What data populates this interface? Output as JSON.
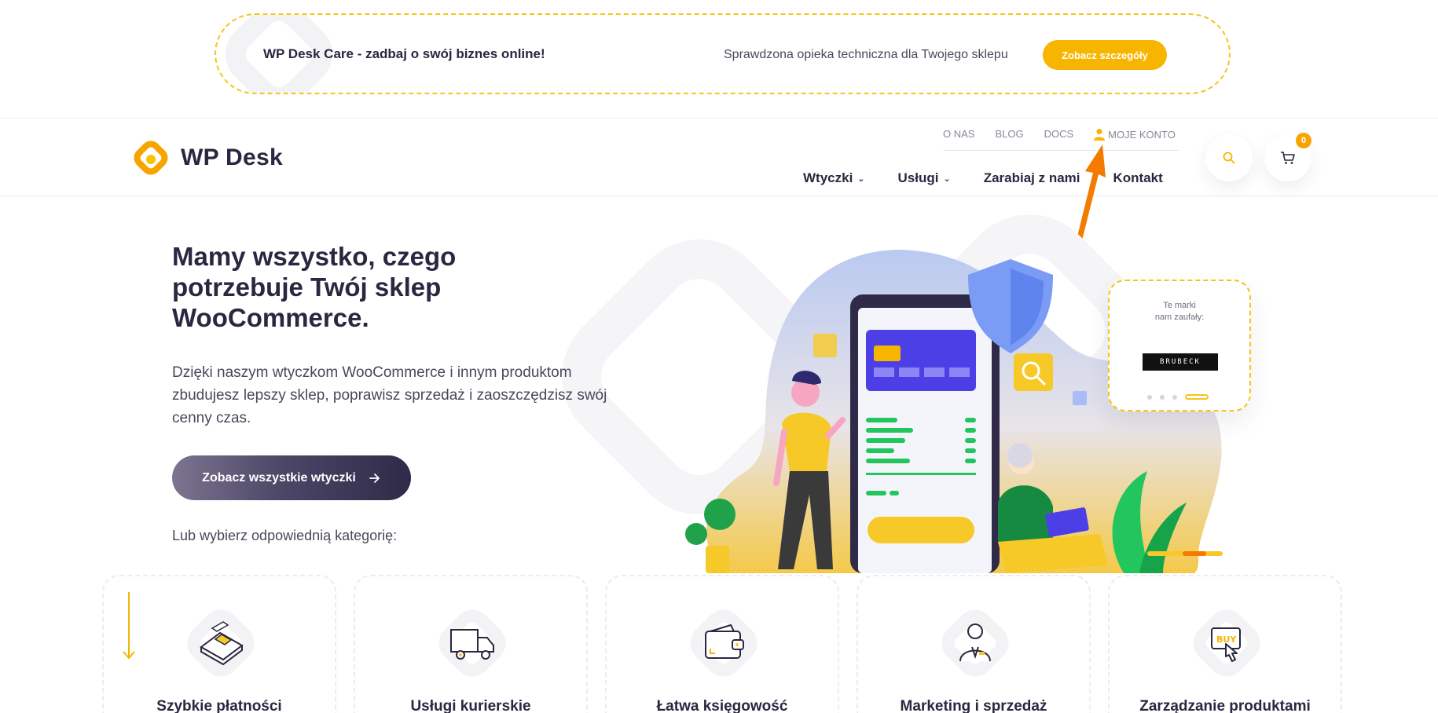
{
  "promo": {
    "title": "WP Desk Care - zadbaj o swój biznes online!",
    "subtitle": "Sprawdzona opieka techniczna dla Twojego sklepu",
    "button": "Zobacz szczegóły"
  },
  "header": {
    "logo_text": "WP Desk",
    "top_nav": [
      "O NAS",
      "BLOG",
      "DOCS"
    ],
    "account_label": "MOJE KONTO",
    "main_nav": [
      {
        "label": "Wtyczki",
        "has_dropdown": true
      },
      {
        "label": "Usługi",
        "has_dropdown": true
      },
      {
        "label": "Zarabiaj z nami",
        "has_dropdown": false
      },
      {
        "label": "Kontakt",
        "has_dropdown": false
      }
    ],
    "cart_count": "0"
  },
  "hero": {
    "title": "Mamy wszystko, czego potrzebuje Twój sklep WooCommerce.",
    "description": "Dzięki naszym wtyczkom WooCommerce i innym produktom zbudujesz lepszy sklep, poprawisz sprzedaż i zaoszczędzisz swój cenny czas.",
    "button": "Zobacz wszystkie wtyczki",
    "or_text": "Lub wybierz odpowiednią kategorię:"
  },
  "brands": {
    "title": "Te marki\nnam zaufały:",
    "logo_text": "BRUBECK"
  },
  "categories": [
    {
      "label": "Szybkie płatności",
      "icon": "payment-terminal-icon"
    },
    {
      "label": "Usługi kurierskie",
      "icon": "delivery-truck-icon"
    },
    {
      "label": "Łatwa księgowość",
      "icon": "wallet-icon"
    },
    {
      "label": "Marketing i sprzedaż",
      "icon": "salesperson-icon"
    },
    {
      "label": "Zarządzanie produktami",
      "icon": "buy-click-icon"
    }
  ],
  "colors": {
    "accent": "#f7b500",
    "dark": "#2a2740",
    "annotation_arrow": "#f47a00"
  }
}
